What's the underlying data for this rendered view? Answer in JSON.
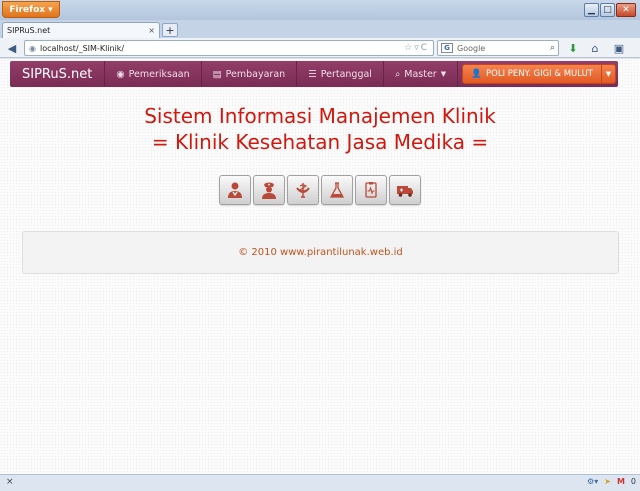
{
  "browser": {
    "menu_button": "Firefox",
    "tab_title": "SIPRuS.net",
    "tab_close": "×",
    "new_tab": "+",
    "url": "localhost/_SIM-Klinik/",
    "search_engine_icon": "G",
    "search_placeholder": "Google",
    "status_close": "×",
    "status_count": "0"
  },
  "app_nav": {
    "brand": "SIPRuS.net",
    "items": [
      {
        "label": "Pemeriksaan",
        "icon": "eye-icon"
      },
      {
        "label": "Pembayaran",
        "icon": "printer-icon"
      },
      {
        "label": "Pertanggal",
        "icon": "list-icon"
      },
      {
        "label": "Master",
        "icon": "search-icon"
      }
    ],
    "poli_button": "POLI PENY. GIGI & MULUT"
  },
  "hero": {
    "line1": "Sistem Informasi Manajemen Klinik",
    "line2": "= Klinik Kesehatan Jasa Medika ="
  },
  "module_icons": [
    "doctor-icon",
    "nurse-icon",
    "pharmacy-icon",
    "lab-flask-icon",
    "medical-record-icon",
    "ambulance-icon"
  ],
  "footer": {
    "text": "© 2010 www.pirantilunak.web.id"
  },
  "colors": {
    "nav_bg": "#87345e",
    "hero_text": "#d0180f",
    "poli_button": "#ec6a33",
    "footer_text": "#c0551e"
  }
}
